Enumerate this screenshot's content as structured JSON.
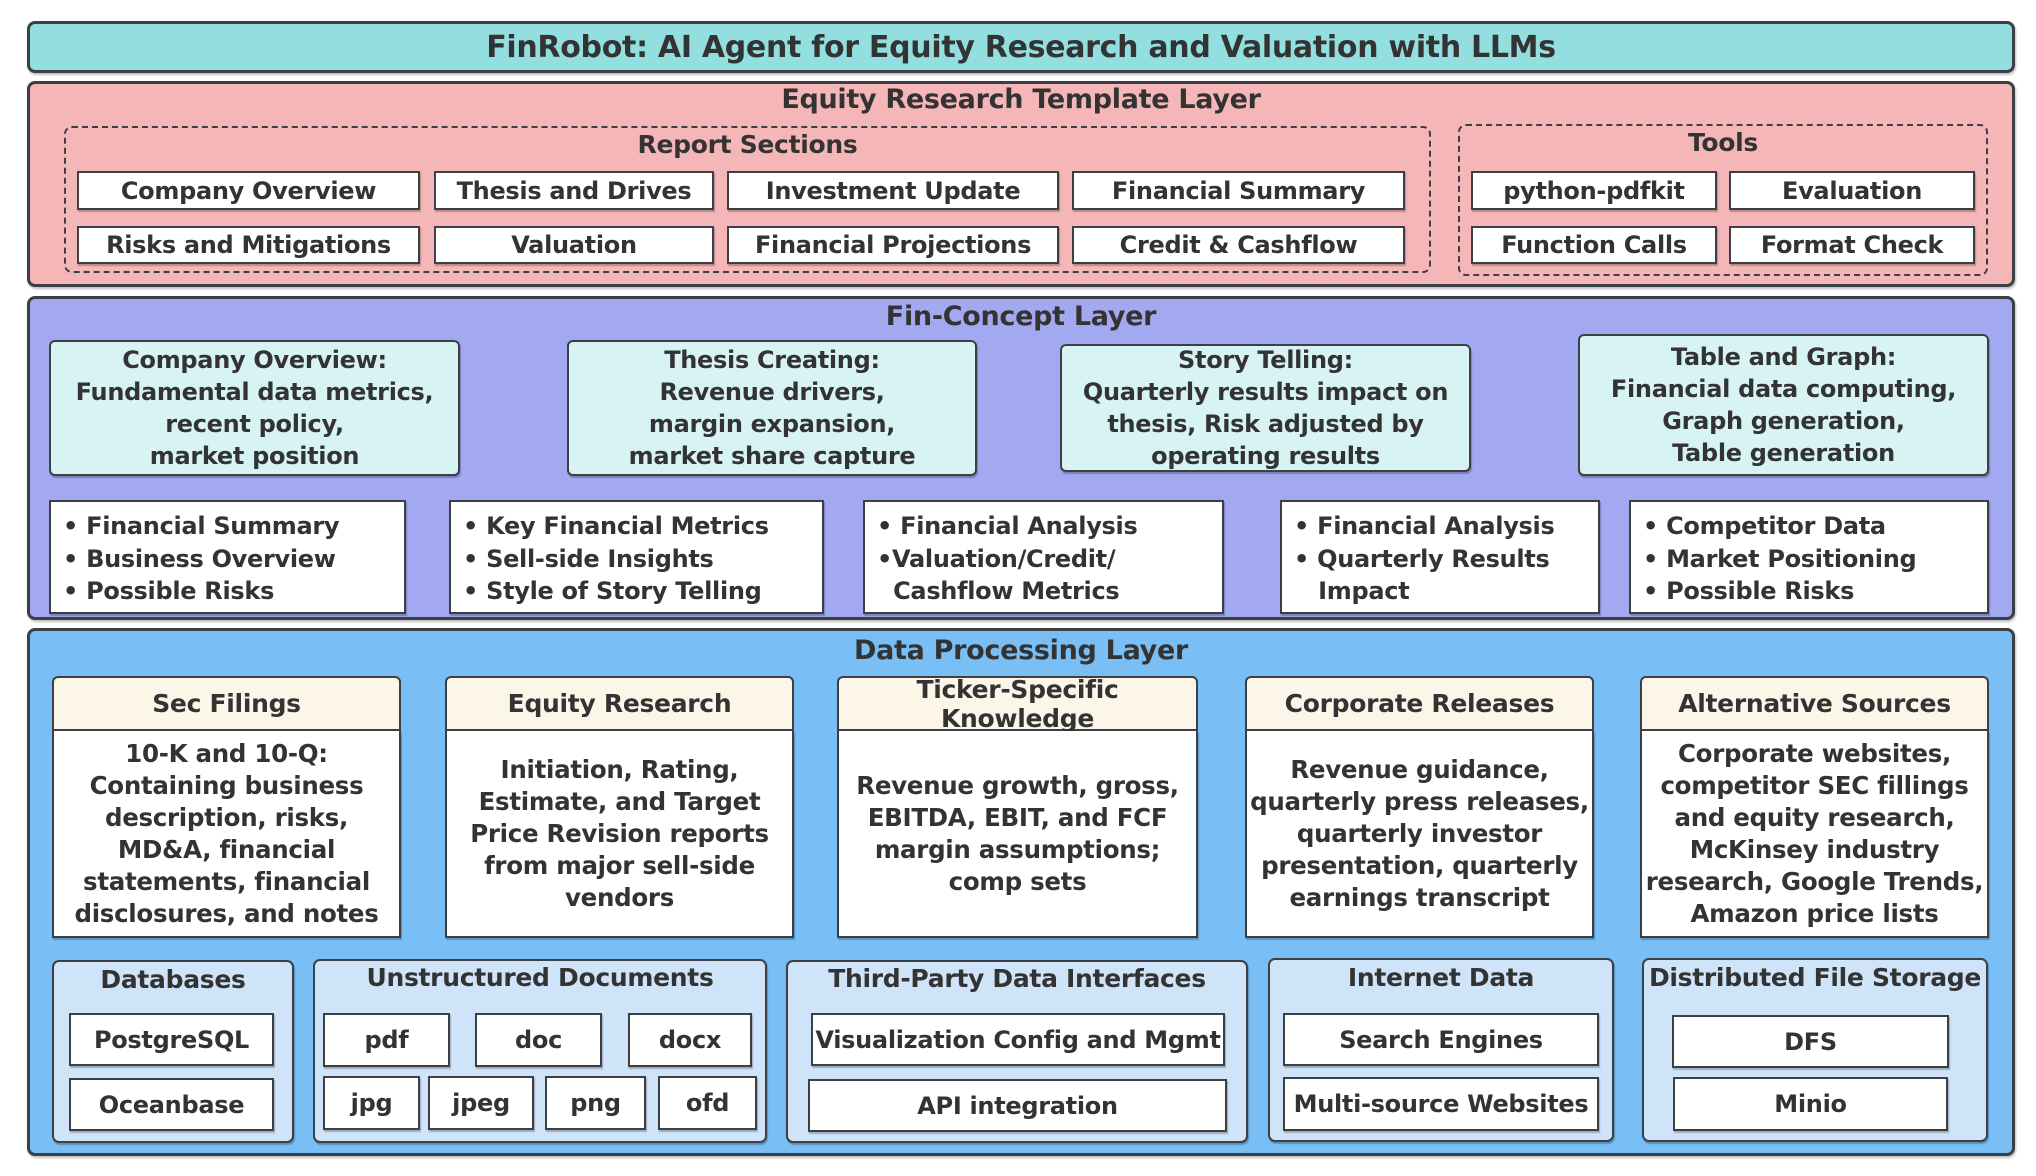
{
  "title": "FinRobot: AI Agent for Equity Research and Valuation with LLMs",
  "colors": {
    "title_fill": "#93dfe0",
    "template_layer_fill": "#f4b6b6",
    "concept_layer_fill": "#a3a9f1",
    "data_layer_fill": "#79bff5",
    "concept_box_fill": "#d8f3f4",
    "source_header_fill": "#fbf6e7",
    "storage_group_fill": "#cfe4f9",
    "border": "#3c3f44",
    "text": "#333333"
  },
  "template_layer": {
    "title": "Equity Research Template Layer",
    "report_sections": {
      "title": "Report Sections",
      "items": [
        "Company Overview",
        "Thesis and Drives",
        "Investment Update",
        "Financial Summary",
        "Risks and Mitigations",
        "Valuation",
        "Financial Projections",
        "Credit & Cashflow"
      ]
    },
    "tools": {
      "title": "Tools",
      "items": [
        "python-pdfkit",
        "Evaluation",
        "Function Calls",
        "Format Check"
      ]
    }
  },
  "concept_layer": {
    "title": "Fin-Concept Layer",
    "concepts": [
      {
        "lines": [
          "Company Overview:",
          "Fundamental data metrics,",
          "recent policy,",
          "market position"
        ]
      },
      {
        "lines": [
          "Thesis Creating:",
          "Revenue drivers,",
          "margin expansion,",
          "market share capture"
        ]
      },
      {
        "lines": [
          "Story Telling:",
          "Quarterly results impact on",
          "thesis, Risk adjusted by",
          "operating results"
        ]
      },
      {
        "lines": [
          "Table and Graph:",
          "Financial data computing,",
          "Graph generation,",
          "Table generation"
        ]
      }
    ],
    "bullet_lists": [
      {
        "lines": [
          "• Financial Summary",
          "• Business Overview",
          "• Possible Risks"
        ]
      },
      {
        "lines": [
          "• Key Financial Metrics",
          "• Sell-side Insights",
          "• Style of Story Telling"
        ]
      },
      {
        "lines": [
          "• Financial Analysis",
          "•Valuation/Credit/",
          "  Cashflow Metrics"
        ]
      },
      {
        "lines": [
          "• Financial Analysis",
          "• Quarterly Results",
          "   Impact"
        ]
      },
      {
        "lines": [
          "• Competitor Data",
          "• Market Positioning",
          "• Possible Risks"
        ]
      }
    ]
  },
  "data_layer": {
    "title": "Data Processing Layer",
    "sources": [
      {
        "title": "Sec Filings",
        "lines": [
          "10-K and 10-Q:",
          "Containing business",
          "description, risks,",
          "MD&A, financial",
          "statements, financial",
          "disclosures, and notes"
        ]
      },
      {
        "title": "Equity Research",
        "lines": [
          "Initiation, Rating,",
          "Estimate, and Target",
          "Price Revision reports",
          "from major sell-side",
          "vendors"
        ]
      },
      {
        "title": "Ticker-Specific Knowledge",
        "lines": [
          "Revenue growth, gross,",
          "EBITDA, EBIT, and FCF",
          "margin assumptions;",
          "comp sets"
        ]
      },
      {
        "title": "Corporate Releases",
        "lines": [
          "Revenue guidance,",
          "quarterly press releases,",
          "quarterly investor",
          "presentation, quarterly",
          "earnings transcript"
        ]
      },
      {
        "title": "Alternative Sources",
        "lines": [
          "Corporate websites,",
          "competitor SEC fillings",
          "and equity research,",
          "McKinsey industry",
          "research, Google Trends,",
          "Amazon price lists"
        ]
      }
    ],
    "storage": {
      "databases": {
        "title": "Databases",
        "items": [
          "PostgreSQL",
          "Oceanbase"
        ]
      },
      "unstructured": {
        "title": "Unstructured Documents",
        "items": [
          "pdf",
          "doc",
          "docx",
          "jpg",
          "jpeg",
          "png",
          "ofd"
        ]
      },
      "third_party": {
        "title": "Third-Party Data Interfaces",
        "items": [
          "Visualization Config and Mgmt",
          "API integration"
        ]
      },
      "internet": {
        "title": "Internet Data",
        "items": [
          "Search Engines",
          "Multi-source Websites"
        ]
      },
      "dfs": {
        "title": "Distributed File Storage",
        "items": [
          "DFS",
          "Minio"
        ]
      }
    }
  }
}
